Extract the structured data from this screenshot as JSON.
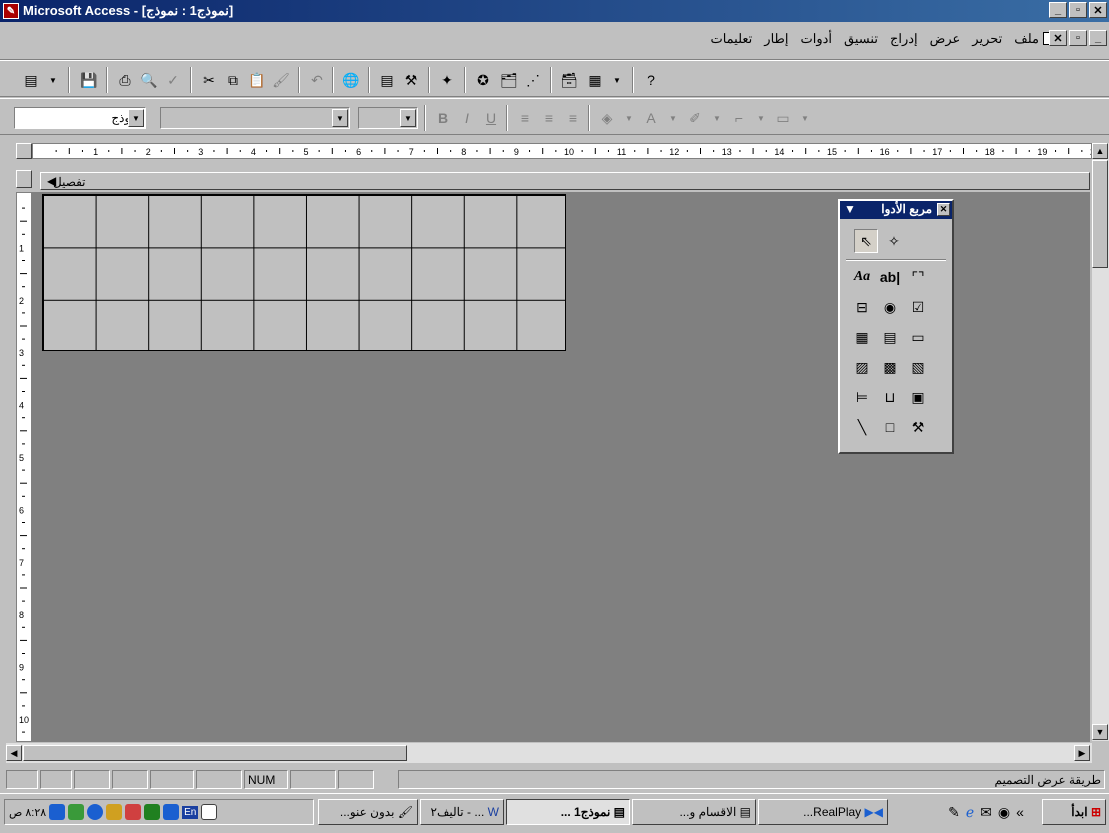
{
  "window": {
    "title": "Microsoft Access - [نموذج1 : نموذج]"
  },
  "menu": {
    "items": [
      "ملف",
      "تحرير",
      "عرض",
      "إدراج",
      "تنسيق",
      "أدوات",
      "إطار",
      "تعليمات"
    ]
  },
  "format_toolbar": {
    "object_combo_value": "نموذج"
  },
  "ruler": {
    "numbers": [
      "1",
      "2",
      "3",
      "4",
      "5",
      "6",
      "7",
      "8",
      "9",
      "10",
      "11",
      "12",
      "13",
      "14",
      "15",
      "16",
      "17",
      "18",
      "19",
      "20"
    ],
    "vertical_numbers": [
      "1",
      "2",
      "3",
      "4",
      "5",
      "6",
      "7",
      "8",
      "9",
      "10"
    ]
  },
  "design": {
    "section_label": "تفصيل"
  },
  "toolbox": {
    "title": "مربع الأدوا",
    "text_tools": [
      "Aa",
      "ab|"
    ]
  },
  "statusbar": {
    "mode_text": "طريقة عرض التصميم",
    "num_indicator": "NUM"
  },
  "taskbar": {
    "start_label": "ابدأ",
    "tasks": [
      {
        "label": "RealPlay..."
      },
      {
        "label": "الاقسام و..."
      },
      {
        "label": "نموذج1 ..."
      },
      {
        "label": "... - تاليف٢"
      },
      {
        "label": "بدون عنو..."
      }
    ],
    "lang_indicator": "En",
    "clock": "٨:٢٨ ص"
  },
  "colors": {
    "title_bar": "#0a246a",
    "workspace": "#808080",
    "chrome": "#c0c0c0"
  }
}
